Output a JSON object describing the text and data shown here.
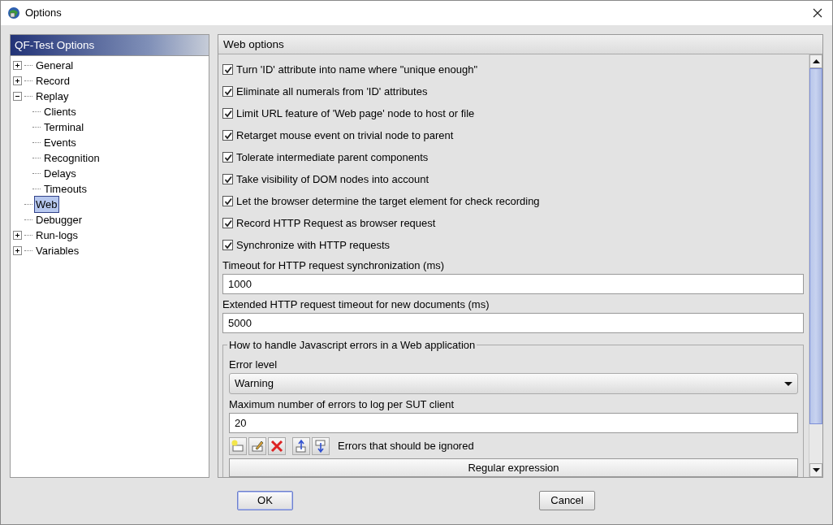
{
  "window": {
    "title": "Options"
  },
  "tree": {
    "title": "QF-Test Options",
    "items": [
      {
        "label": "General",
        "expanded": false,
        "selected": false
      },
      {
        "label": "Record",
        "expanded": false,
        "selected": false
      },
      {
        "label": "Replay",
        "expanded": true,
        "selected": false,
        "children": [
          {
            "label": "Clients",
            "selected": false
          },
          {
            "label": "Terminal",
            "selected": false
          },
          {
            "label": "Events",
            "selected": false
          },
          {
            "label": "Recognition",
            "selected": false
          },
          {
            "label": "Delays",
            "selected": false
          },
          {
            "label": "Timeouts",
            "selected": false
          }
        ]
      },
      {
        "label": "Web",
        "selected": true
      },
      {
        "label": "Debugger",
        "selected": false
      },
      {
        "label": "Run-logs",
        "expanded": false,
        "selected": false
      },
      {
        "label": "Variables",
        "expanded": false,
        "selected": false
      }
    ]
  },
  "panel": {
    "title": "Web options",
    "checkboxes": [
      {
        "label": "Turn 'ID' attribute into name where \"unique enough\"",
        "checked": true
      },
      {
        "label": "Eliminate all numerals from 'ID' attributes",
        "checked": true
      },
      {
        "label": "Limit URL feature of 'Web page' node to host or file",
        "checked": true
      },
      {
        "label": "Retarget mouse event on trivial node to parent",
        "checked": true
      },
      {
        "label": "Tolerate intermediate parent components",
        "checked": true
      },
      {
        "label": "Take visibility of DOM nodes into account",
        "checked": true
      },
      {
        "label": "Let the browser determine the target element for check recording",
        "checked": true
      },
      {
        "label": "Record HTTP Request as browser request",
        "checked": true
      },
      {
        "label": "Synchronize with HTTP requests",
        "checked": true
      }
    ],
    "fields": [
      {
        "label": "Timeout for HTTP request synchronization (ms)",
        "value": "1000"
      },
      {
        "label": "Extended HTTP request timeout for new documents (ms)",
        "value": "5000"
      }
    ],
    "group": {
      "title": "How to handle Javascript errors in a Web application",
      "error_level": {
        "label": "Error level",
        "value": "Warning"
      },
      "max_errors": {
        "label": "Maximum number of errors to log per SUT client",
        "value": "20"
      },
      "ignored": {
        "label": "Errors that should be ignored",
        "columns": [
          "Regular expression"
        ]
      }
    }
  },
  "buttons": [
    {
      "label": "OK",
      "default": true
    },
    {
      "label": "Cancel",
      "default": false
    }
  ]
}
